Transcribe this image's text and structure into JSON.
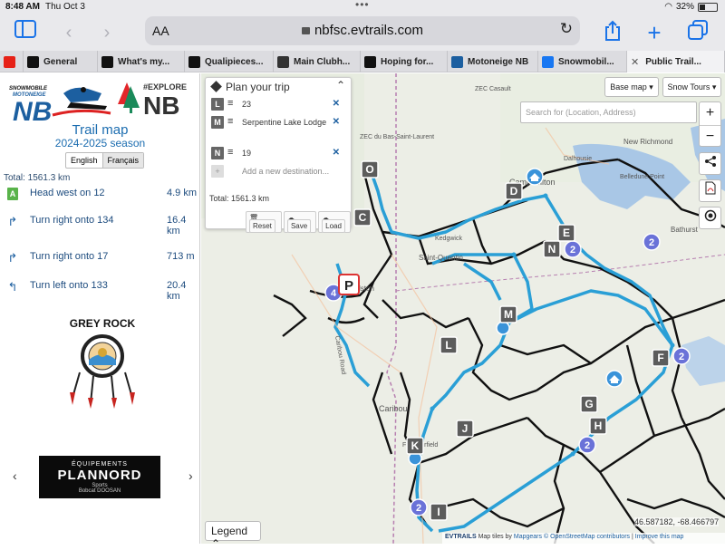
{
  "status": {
    "time": "8:48 AM",
    "date": "Thu Oct 3",
    "battery": "32%",
    "battery_level": 0.32
  },
  "browser": {
    "font_size_button": "AA",
    "url": "nbfsc.evtrails.com",
    "tabs": [
      {
        "label": "",
        "favicon": "youtube-icon",
        "favicon_color": "#e62117"
      },
      {
        "label": "General",
        "favicon": "evtrails-icon",
        "favicon_color": "#111111"
      },
      {
        "label": "What's my...",
        "favicon": "evtrails-icon",
        "favicon_color": "#111111"
      },
      {
        "label": "Qualipieces...",
        "favicon": "evtrails-icon",
        "favicon_color": "#111111"
      },
      {
        "label": "Main Clubh...",
        "favicon": "obs-icon",
        "favicon_color": "#333333"
      },
      {
        "label": "Hoping for...",
        "favicon": "evtrails-icon",
        "favicon_color": "#111111"
      },
      {
        "label": "Motoneige NB",
        "favicon": "snowmobile-icon",
        "favicon_color": "#1c5fa0"
      },
      {
        "label": "Snowmobil...",
        "favicon": "facebook-icon",
        "favicon_color": "#1877f2"
      },
      {
        "label": "Public Trail...",
        "favicon": "close-icon",
        "favicon_color": "#555555"
      }
    ]
  },
  "sidebar": {
    "logo_left_line1": "SNOWMOBILE",
    "logo_left_line2": "MOTONEIGE",
    "logo_left_nb": "NB",
    "logo_right_tag": "#EXPLORE",
    "logo_right_nb": "NB",
    "title": "Trail map",
    "season": "2024-2025 season",
    "lang_en": "English",
    "lang_fr": "Français",
    "total": "Total: 1561.3 km",
    "steps": [
      {
        "icon": "A",
        "text": "Head west on 12",
        "distance": "4.9 km"
      },
      {
        "icon": "turn-right-icon",
        "text": "Turn right onto 134",
        "distance": "16.4 km"
      },
      {
        "icon": "turn-right-icon",
        "text": "Turn right onto 17",
        "distance": "713 m"
      },
      {
        "icon": "turn-left-icon",
        "text": "Turn left onto 133",
        "distance": "20.4 km"
      }
    ],
    "grey_rock": "GREY ROCK",
    "sponsor_line1": "ÉQUIPEMENTS",
    "sponsor_line2": "PLANNORD",
    "sponsor_line3": "Sports",
    "sponsor_line4": "Bobcat          DOOSAN"
  },
  "plan": {
    "title": "Plan your trip",
    "waypoints": [
      {
        "letter": "L",
        "name": "23"
      },
      {
        "letter": "M",
        "name": "Serpentine Lake Lodge"
      },
      {
        "letter": "N",
        "name": "19"
      }
    ],
    "add_placeholder": "Add a new destination...",
    "total": "Total: 1561.3 km",
    "reset": "Reset",
    "save": "Save",
    "load": "Load"
  },
  "map": {
    "base_map": "Base map ▾",
    "snow_tours": "Snow Tours ▾",
    "search_placeholder": "Search for (Location, Address)",
    "zoom_in": "+",
    "zoom_out": "−",
    "legend": "Legend",
    "coords": "46.587182, -68.466797",
    "attribution_prefix": "Map tiles by",
    "attribution_mapgears": "Mapgears",
    "attribution_osm": "© OpenStreetMap contributors",
    "attribution_improve": "Improve this map",
    "evtrails": "EVTRAILS",
    "places": [
      {
        "name": "Campbellton"
      },
      {
        "name": "Dalhousie"
      },
      {
        "name": "New Richmond"
      },
      {
        "name": "ZEC Casault"
      },
      {
        "name": "Belledune Point"
      },
      {
        "name": "Bathurst"
      },
      {
        "name": "Saint-Quentin"
      },
      {
        "name": "Kedgwick"
      },
      {
        "name": "Edmundston"
      },
      {
        "name": "Caribou"
      },
      {
        "name": "Fort Fairfield"
      },
      {
        "name": "Caribou Road"
      },
      {
        "name": "ZEC du Bas-Saint-Laurent"
      }
    ],
    "markers": [
      "O",
      "B",
      "C",
      "D",
      "E",
      "N",
      "M",
      "L",
      "F",
      "G",
      "H",
      "J",
      "K",
      "I"
    ],
    "clusters": [
      "2",
      "2",
      "4",
      "2",
      "2",
      "2"
    ],
    "route_color": "#2a9fd6",
    "trail_color": "#111111",
    "water_color": "#a9c7e6"
  }
}
